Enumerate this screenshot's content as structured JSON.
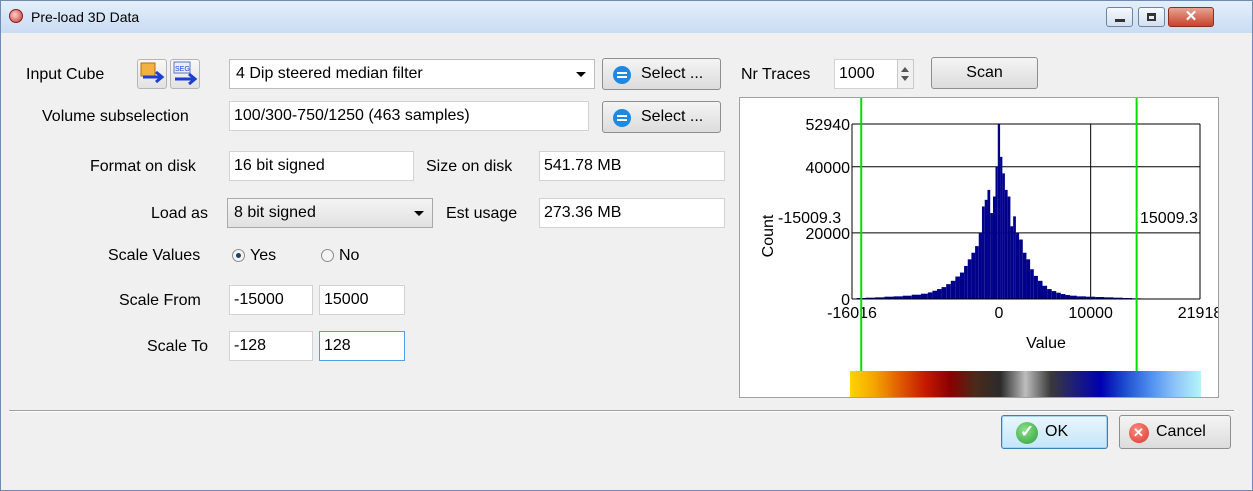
{
  "window": {
    "title": "Pre-load 3D Data",
    "controls": {
      "minimize": "minimize",
      "maximize": "maximize",
      "close": "✕"
    }
  },
  "input_cube": {
    "label": "Input Cube",
    "value": "4 Dip steered median filter",
    "select_button": "Select ...",
    "icons": [
      "load-cube-icon",
      "seg-y-import-icon"
    ]
  },
  "volume": {
    "label": "Volume subselection",
    "value": "100/300-750/1250 (463 samples)",
    "select_button": "Select ..."
  },
  "format": {
    "label": "Format on disk",
    "value": "16 bit signed"
  },
  "size": {
    "label": "Size on disk",
    "value": "541.78 MB"
  },
  "load_as": {
    "label": "Load as",
    "value": "8  bit signed"
  },
  "est_usage": {
    "label": "Est usage",
    "value": "273.36 MB"
  },
  "scale_values": {
    "label": "Scale Values",
    "yes": "Yes",
    "no": "No",
    "selected": "Yes"
  },
  "scale_from": {
    "label": "Scale From",
    "min": "-15000",
    "max": "15000"
  },
  "scale_to": {
    "label": "Scale To",
    "min": "-128",
    "max": "128"
  },
  "nr_traces": {
    "label": "Nr Traces",
    "value": "1000",
    "scan_button": "Scan"
  },
  "buttons": {
    "ok": "OK",
    "cancel": "Cancel"
  },
  "colors": {
    "histogram": "#00008b",
    "clip_line": "#00e000"
  },
  "chart_data": {
    "type": "bar",
    "xlabel": "Value",
    "ylabel": "Count",
    "xlim": [
      -16016,
      21918
    ],
    "ylim": [
      0,
      52940
    ],
    "x_ticks": [
      "-16016",
      "0",
      "10000",
      "21918"
    ],
    "y_ticks": [
      "0",
      "20000",
      "40000",
      "52940"
    ],
    "clip_left_label": "-15009.3",
    "clip_right_label": "15009.3",
    "clip_values": [
      -15009.3,
      15009.3
    ],
    "grid": true,
    "x": [
      -15000,
      -14000,
      -13000,
      -12000,
      -11000,
      -10000,
      -9000,
      -8000,
      -7500,
      -7000,
      -6500,
      -6000,
      -5500,
      -5000,
      -4500,
      -4000,
      -3600,
      -3200,
      -2800,
      -2400,
      -2000,
      -1700,
      -1400,
      -1100,
      -800,
      -500,
      -250,
      0,
      250,
      500,
      800,
      1100,
      1400,
      1700,
      2000,
      2400,
      2800,
      3200,
      3600,
      4000,
      4500,
      5000,
      5500,
      6000,
      6500,
      7000,
      7500,
      8000,
      9000,
      10000,
      11000,
      12000,
      13000,
      14000,
      15000
    ],
    "values": [
      300,
      400,
      500,
      700,
      800,
      1000,
      1300,
      1600,
      2000,
      2500,
      3000,
      3600,
      4500,
      5500,
      6800,
      8000,
      10000,
      12000,
      14000,
      16000,
      20000,
      28000,
      30000,
      33000,
      26000,
      31000,
      40000,
      54000,
      43000,
      38000,
      33000,
      31000,
      22000,
      25000,
      20000,
      18000,
      14000,
      12000,
      9000,
      7000,
      5500,
      4000,
      3000,
      2400,
      1900,
      1500,
      1200,
      1000,
      800,
      700,
      600,
      500,
      400,
      300,
      200
    ],
    "colorbar": [
      "#ffd400",
      "#f4a300",
      "#e05a00",
      "#c41a00",
      "#8b0000",
      "#4a2a1a",
      "#2b2b2b",
      "#bdbdbd",
      "#3a3a3a",
      "#1c1c7a",
      "#0000b0",
      "#1f4fd0",
      "#4f8ff0",
      "#8fc6f8",
      "#b3f5fa"
    ]
  }
}
